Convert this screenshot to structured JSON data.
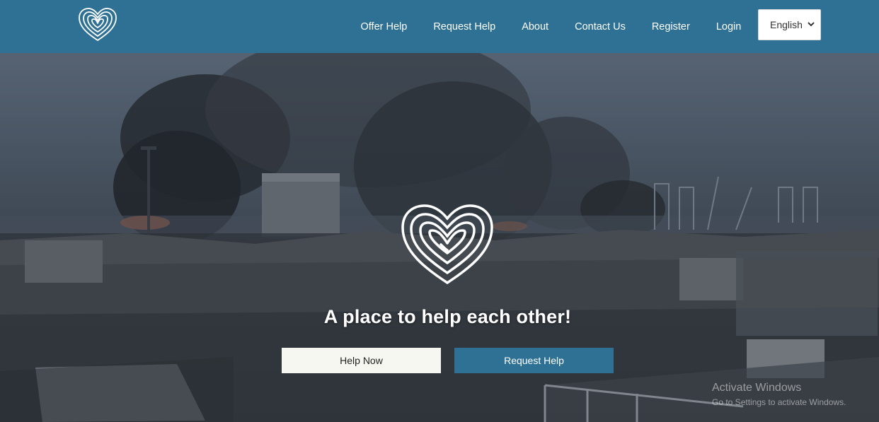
{
  "nav": {
    "logo_icon": "fingerprint-heart-icon",
    "links": [
      "Offer Help",
      "Request Help",
      "About",
      "Contact Us",
      "Register",
      "Login"
    ],
    "language": "English"
  },
  "hero": {
    "logo_icon": "fingerprint-heart-icon",
    "tagline": "A place to help each other!",
    "primary_button": "Help Now",
    "secondary_button": "Request Help"
  },
  "watermark": {
    "title": "Activate Windows",
    "subtitle": "Go to Settings to activate Windows."
  },
  "colors": {
    "navbar": "#2f7194",
    "primary_button_bg": "#f7f7f2",
    "secondary_button_bg": "#2f7194",
    "text_light": "#ffffff"
  }
}
